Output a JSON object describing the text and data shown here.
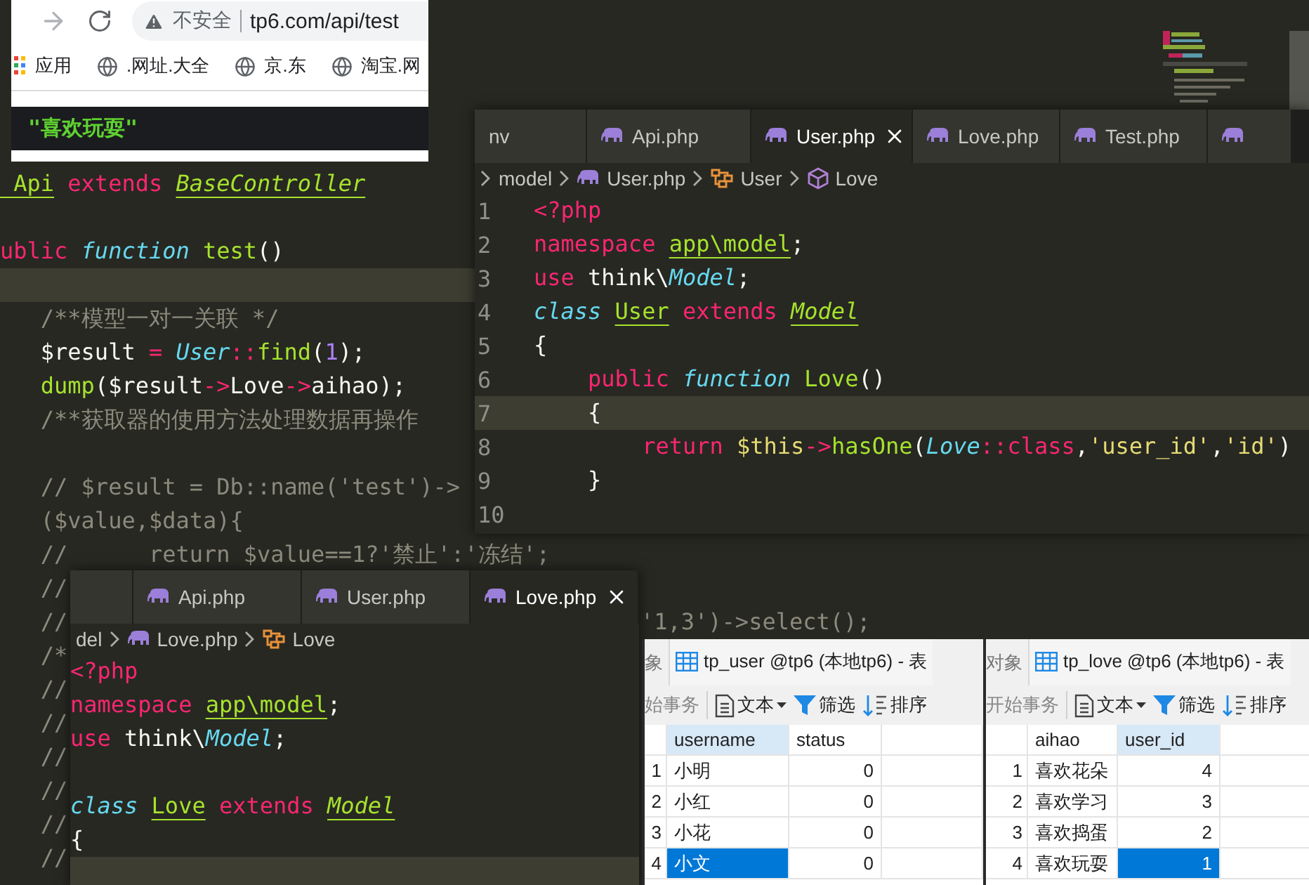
{
  "browser": {
    "security": "不安全",
    "url": "tp6.com/api/test",
    "bookmarks": [
      {
        "kind": "apps",
        "label": "应用"
      },
      {
        "kind": "site",
        "label": ".网址.大全"
      },
      {
        "kind": "site",
        "label": "京.东"
      },
      {
        "kind": "site",
        "label": "淘宝.网"
      }
    ],
    "output": "\"喜欢玩耍\""
  },
  "background_editor": {
    "lines": [
      {
        "current": false,
        "tokens": [
          {
            "text": " Api",
            "kind": "type"
          },
          {
            "text": " extends ",
            "kind": "keyword"
          },
          {
            "text": "BaseController",
            "kind": "type-italic"
          }
        ]
      },
      {
        "current": false
      },
      {
        "current": false,
        "tokens": [
          {
            "text": "ublic ",
            "kind": "keyword"
          },
          {
            "text": "function",
            "kind": "storage"
          },
          {
            "text": " test",
            "kind": "func"
          },
          {
            "text": "()",
            "kind": "plain"
          }
        ]
      },
      {
        "current": true
      },
      {
        "current": false,
        "tokens": [
          {
            "text": "   /**模型一对一关联 */",
            "kind": "comment"
          }
        ]
      },
      {
        "current": false,
        "tokens": [
          {
            "text": "   $result",
            "kind": "plain"
          },
          {
            "text": " = ",
            "kind": "keyword"
          },
          {
            "text": "User",
            "kind": "storage"
          },
          {
            "text": "::",
            "kind": "keyword"
          },
          {
            "text": "find",
            "kind": "func"
          },
          {
            "text": "(",
            "kind": "plain"
          },
          {
            "text": "1",
            "kind": "number"
          },
          {
            "text": ");",
            "kind": "plain"
          }
        ]
      },
      {
        "current": false,
        "tokens": [
          {
            "text": "   dump",
            "kind": "func"
          },
          {
            "text": "($result",
            "kind": "plain"
          },
          {
            "text": "->",
            "kind": "keyword"
          },
          {
            "text": "Love",
            "kind": "plain"
          },
          {
            "text": "->",
            "kind": "keyword"
          },
          {
            "text": "aihao);",
            "kind": "plain"
          }
        ]
      },
      {
        "current": false,
        "tokens": [
          {
            "text": "   /**获取器的使用方法处理数据再操作",
            "kind": "comment"
          }
        ]
      },
      {
        "current": false
      },
      {
        "current": false,
        "tokens": [
          {
            "text": "   // $result = Db::name('test')->",
            "kind": "comment"
          }
        ]
      },
      {
        "current": false,
        "tokens": [
          {
            "text": "   ($value,$data){",
            "kind": "comment"
          }
        ]
      },
      {
        "current": false,
        "tokens": [
          {
            "text": "   //      return $value==1?'禁止':'冻结';",
            "kind": "comment"
          }
        ]
      },
      {
        "current": false,
        "tokens": [
          {
            "text": "   //",
            "kind": "comment"
          }
        ]
      },
      {
        "current": false,
        "tokens": [
          {
            "text": "   //",
            "kind": "comment"
          }
        ],
        "tail": "'1,3')->select();"
      },
      {
        "current": false,
        "tokens": [
          {
            "text": "   /*",
            "kind": "comment"
          }
        ]
      },
      {
        "current": false,
        "tokens": [
          {
            "text": "   //",
            "kind": "comment"
          }
        ]
      },
      {
        "current": false,
        "tokens": [
          {
            "text": "   //",
            "kind": "comment"
          }
        ]
      },
      {
        "current": false,
        "tokens": [
          {
            "text": "   //",
            "kind": "comment"
          }
        ]
      },
      {
        "current": false,
        "tokens": [
          {
            "text": "   //",
            "kind": "comment"
          }
        ]
      },
      {
        "current": false,
        "tokens": [
          {
            "text": "   //",
            "kind": "comment"
          }
        ]
      },
      {
        "current": false,
        "tokens": [
          {
            "text": "   //",
            "kind": "comment"
          }
        ]
      }
    ]
  },
  "user_editor": {
    "tabs": [
      {
        "label": "nv",
        "selected": false
      },
      {
        "label": "Api.php",
        "selected": false
      },
      {
        "label": "User.php",
        "selected": true
      },
      {
        "label": "Love.php",
        "selected": false
      },
      {
        "label": "Test.php",
        "selected": false
      }
    ],
    "breadcrumb": [
      {
        "kind": "folder",
        "text": "model"
      },
      {
        "kind": "php",
        "text": "User.php"
      },
      {
        "kind": "class",
        "text": "User"
      },
      {
        "kind": "method",
        "text": "Love"
      }
    ],
    "lines": [
      {
        "number": "1",
        "current": false,
        "tokens": [
          {
            "text": "<?php",
            "kind": "keyword"
          }
        ]
      },
      {
        "number": "2",
        "current": false,
        "tokens": [
          {
            "text": "namespace ",
            "kind": "keyword"
          },
          {
            "text": "app\\model",
            "kind": "type"
          },
          {
            "text": ";",
            "kind": "plain"
          }
        ]
      },
      {
        "number": "3",
        "current": false,
        "tokens": [
          {
            "text": "use ",
            "kind": "keyword"
          },
          {
            "text": "think\\",
            "kind": "plain"
          },
          {
            "text": "Model",
            "kind": "storage"
          },
          {
            "text": ";",
            "kind": "plain"
          }
        ]
      },
      {
        "number": "4",
        "current": false,
        "tokens": [
          {
            "text": "class ",
            "kind": "storage"
          },
          {
            "text": "User",
            "kind": "type"
          },
          {
            "text": " extends ",
            "kind": "keyword"
          },
          {
            "text": "Model",
            "kind": "type-italic"
          }
        ]
      },
      {
        "number": "5",
        "current": false,
        "tokens": [
          {
            "text": "{",
            "kind": "plain"
          }
        ]
      },
      {
        "number": "6",
        "current": false,
        "tokens": [
          {
            "text": "    public ",
            "kind": "keyword"
          },
          {
            "text": "function",
            "kind": "storage"
          },
          {
            "text": " Love",
            "kind": "func"
          },
          {
            "text": "()",
            "kind": "plain"
          }
        ]
      },
      {
        "number": "7",
        "current": true,
        "tokens": [
          {
            "text": "    {",
            "kind": "plain"
          }
        ]
      },
      {
        "number": "8",
        "current": false,
        "tokens": [
          {
            "text": "        return ",
            "kind": "keyword"
          },
          {
            "text": "$this",
            "kind": "string"
          },
          {
            "text": "->",
            "kind": "keyword"
          },
          {
            "text": "hasOne",
            "kind": "func"
          },
          {
            "text": "(",
            "kind": "plain"
          },
          {
            "text": "Love",
            "kind": "storage"
          },
          {
            "text": "::class",
            "kind": "keyword"
          },
          {
            "text": ",",
            "kind": "plain"
          },
          {
            "text": "'user_id'",
            "kind": "string"
          },
          {
            "text": ",",
            "kind": "plain"
          },
          {
            "text": "'id'",
            "kind": "string"
          },
          {
            "text": ")",
            "kind": "plain"
          }
        ]
      },
      {
        "number": "9",
        "current": false,
        "tokens": [
          {
            "text": "    }",
            "kind": "plain"
          }
        ]
      },
      {
        "number": "10",
        "current": false
      }
    ]
  },
  "love_editor": {
    "tabs": [
      {
        "label": "Api.php",
        "selected": false
      },
      {
        "label": "User.php",
        "selected": false
      },
      {
        "label": "Love.php",
        "selected": true
      }
    ],
    "breadcrumb": [
      {
        "kind": "folder",
        "text": "del"
      },
      {
        "kind": "php",
        "text": "Love.php"
      },
      {
        "kind": "class",
        "text": "Love"
      }
    ],
    "lines": [
      {
        "current": false,
        "tokens": [
          {
            "text": "<?php",
            "kind": "keyword"
          }
        ]
      },
      {
        "current": false,
        "tokens": [
          {
            "text": "namespace ",
            "kind": "keyword"
          },
          {
            "text": "app\\model",
            "kind": "type"
          },
          {
            "text": ";",
            "kind": "plain"
          }
        ]
      },
      {
        "current": false,
        "tokens": [
          {
            "text": "use ",
            "kind": "keyword"
          },
          {
            "text": "think\\",
            "kind": "plain"
          },
          {
            "text": "Model",
            "kind": "storage"
          },
          {
            "text": ";",
            "kind": "plain"
          }
        ]
      },
      {
        "current": false
      },
      {
        "current": false,
        "tokens": [
          {
            "text": "class ",
            "kind": "storage"
          },
          {
            "text": "Love",
            "kind": "type"
          },
          {
            "text": " extends ",
            "kind": "keyword"
          },
          {
            "text": "Model",
            "kind": "type-italic"
          }
        ]
      },
      {
        "current": false,
        "tokens": [
          {
            "text": "{",
            "kind": "plain"
          }
        ]
      },
      {
        "current": true
      }
    ]
  },
  "tables": [
    {
      "side_tab": "象",
      "title": "tp_user @tp6 (本地tp6) - 表",
      "toolbar": [
        {
          "kind": "text",
          "label": "始事务"
        },
        {
          "kind": "doc-menu",
          "label": "文本"
        },
        {
          "kind": "filter",
          "label": "筛选"
        },
        {
          "kind": "sort",
          "label": "排序"
        }
      ],
      "columns": [
        {
          "label": "username",
          "selected": true
        },
        {
          "label": "status",
          "selected": false
        }
      ],
      "rows": [
        {
          "number": "1",
          "cells": [
            {
              "text": "小明",
              "selected": false
            },
            {
              "text": "0",
              "selected": false
            }
          ]
        },
        {
          "number": "2",
          "cells": [
            {
              "text": "小红",
              "selected": false
            },
            {
              "text": "0",
              "selected": false
            }
          ]
        },
        {
          "number": "3",
          "cells": [
            {
              "text": "小花",
              "selected": false
            },
            {
              "text": "0",
              "selected": false
            }
          ]
        },
        {
          "number": "4",
          "cells": [
            {
              "text": "小文",
              "selected": true
            },
            {
              "text": "0",
              "selected": false
            }
          ]
        }
      ]
    },
    {
      "side_tab": "对象",
      "title": "tp_love @tp6 (本地tp6) - 表",
      "toolbar": [
        {
          "kind": "text",
          "label": "开始事务"
        },
        {
          "kind": "doc-menu",
          "label": "文本"
        },
        {
          "kind": "filter",
          "label": "筛选"
        },
        {
          "kind": "sort",
          "label": "排序"
        }
      ],
      "columns": [
        {
          "label": "aihao",
          "selected": false
        },
        {
          "label": "user_id",
          "selected": true
        }
      ],
      "rows": [
        {
          "number": "1",
          "cells": [
            {
              "text": "喜欢花朵",
              "selected": false
            },
            {
              "text": "4",
              "selected": false
            }
          ]
        },
        {
          "number": "2",
          "cells": [
            {
              "text": "喜欢学习",
              "selected": false
            },
            {
              "text": "3",
              "selected": false
            }
          ]
        },
        {
          "number": "3",
          "cells": [
            {
              "text": "喜欢捣蛋",
              "selected": false
            },
            {
              "text": "2",
              "selected": false
            }
          ]
        },
        {
          "number": "4",
          "cells": [
            {
              "text": "喜欢玩耍",
              "selected": false
            },
            {
              "text": "1",
              "selected": true
            }
          ]
        }
      ]
    }
  ]
}
